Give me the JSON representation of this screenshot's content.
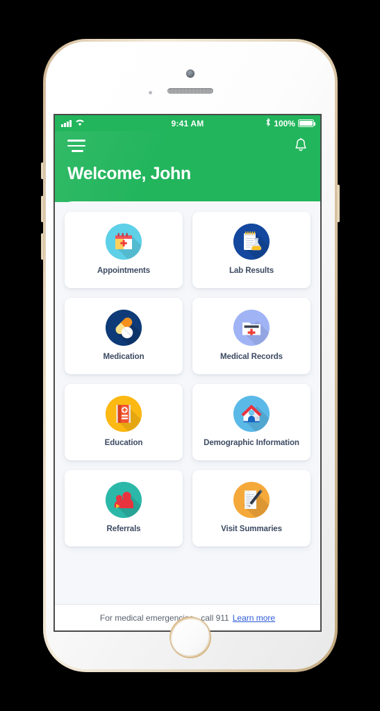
{
  "status_bar": {
    "signal_icon": "cellular-signal-icon",
    "wifi_icon": "wifi-icon",
    "time": "9:41 AM",
    "bluetooth_icon": "bluetooth-icon",
    "battery_percent": "100%",
    "battery_icon": "battery-full-icon"
  },
  "header": {
    "menu_icon": "hamburger-menu-icon",
    "notification_icon": "bell-icon",
    "greeting": "Welcome, John",
    "background_color": "#22B55C"
  },
  "tiles": [
    {
      "label": "Appointments",
      "icon": "calendar-medical-icon",
      "circle_color": "#5ED0E8"
    },
    {
      "label": "Lab Results",
      "icon": "notepad-flask-icon",
      "circle_color": "#14489E"
    },
    {
      "label": "Medication",
      "icon": "pill-capsule-icon",
      "circle_color": "#0E3B77"
    },
    {
      "label": "Medical Records",
      "icon": "file-folder-medical-icon",
      "circle_color": "#A0B4F5"
    },
    {
      "label": "Education",
      "icon": "medical-book-icon",
      "circle_color": "#FCB813"
    },
    {
      "label": "Demographic Information",
      "icon": "house-person-icon",
      "circle_color": "#5BB9E8"
    },
    {
      "label": "Referrals",
      "icon": "two-people-icon",
      "circle_color": "#2CB8A8"
    },
    {
      "label": "Visit Summaries",
      "icon": "document-pen-icon",
      "circle_color": "#F5A93A"
    }
  ],
  "footer": {
    "text": "For medical emergencies - call 911",
    "link_label": "Learn more",
    "link_color": "#2d5bd7"
  }
}
